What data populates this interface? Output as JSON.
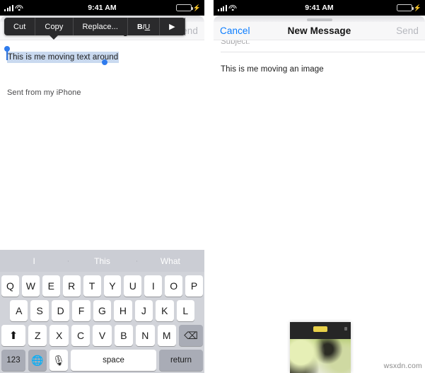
{
  "status_bar": {
    "time": "9:41 AM",
    "signal_icon": "cellular-bars-icon",
    "wifi_icon": "wifi-icon",
    "battery_icon": "battery-icon",
    "charging_icon": "lightning-bolt-icon",
    "battery_color": "#35d74b",
    "background": "#000000"
  },
  "nav": {
    "cancel_label": "Cancel",
    "title": "New Message",
    "send_label": "Send",
    "cancel_color": "#0a7cff",
    "send_color": "#b6b8be"
  },
  "left_phone": {
    "callout": {
      "items": [
        "Cut",
        "Copy",
        "Replace..."
      ],
      "format_label": "B/U",
      "format_bold": "B",
      "format_italic": "I",
      "format_underline": "U",
      "more_arrow": "▶"
    },
    "selected_text": "This is me moving text around",
    "selection_color": "#c9d9ef",
    "handle_color": "#2f7bed",
    "signature": "Sent from my iPhone"
  },
  "right_phone": {
    "subject_placeholder": "Subject:",
    "body_text": "This is me moving an image",
    "dragged_image": "dragged-photo-thumbnail"
  },
  "keyboard": {
    "suggestions": [
      "I",
      "This",
      "What"
    ],
    "row1": [
      "Q",
      "W",
      "E",
      "R",
      "T",
      "Y",
      "U",
      "I",
      "O",
      "P"
    ],
    "row2": [
      "A",
      "S",
      "D",
      "F",
      "G",
      "H",
      "J",
      "K",
      "L"
    ],
    "row3": [
      "Z",
      "X",
      "C",
      "V",
      "B",
      "N",
      "M"
    ],
    "shift_icon": "⬆",
    "delete_icon": "⌫",
    "numbers_label": "123",
    "globe_icon": "🌐",
    "mic_icon": "🎙",
    "space_label": "space",
    "return_label": "return"
  },
  "watermark": "wsxdn.com"
}
